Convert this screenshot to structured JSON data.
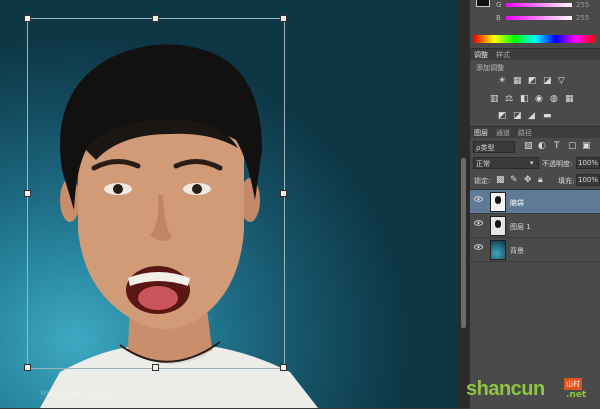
{
  "color_panel": {
    "channel_g": "G",
    "channel_b": "B",
    "value_g": "255",
    "value_b": "255"
  },
  "adjustments": {
    "tabs": [
      "调整",
      "样式"
    ],
    "hint": "添加调整"
  },
  "layers_panel": {
    "tabs": [
      "图层",
      "通道",
      "路径"
    ],
    "filter_label": "ρ类型",
    "blend_mode": "正常",
    "opacity_label": "不透明度:",
    "opacity_value": "100%",
    "lock_label": "锁定:",
    "fill_label": "填充:",
    "fill_value": "100%",
    "layers": [
      {
        "name": "脑袋",
        "selected": true
      },
      {
        "name": "图层 1",
        "selected": false
      },
      {
        "name": "背景",
        "selected": false
      }
    ]
  },
  "watermark": {
    "site_text": "shancun",
    "site_suffix": ".net",
    "badge_text": "山村",
    "left_text": "www.shancun.net"
  },
  "colors": {
    "accent_selected": "#5e7a96",
    "panel_bg": "#4a4a4a",
    "canvas_bg": "#1d6a82"
  }
}
